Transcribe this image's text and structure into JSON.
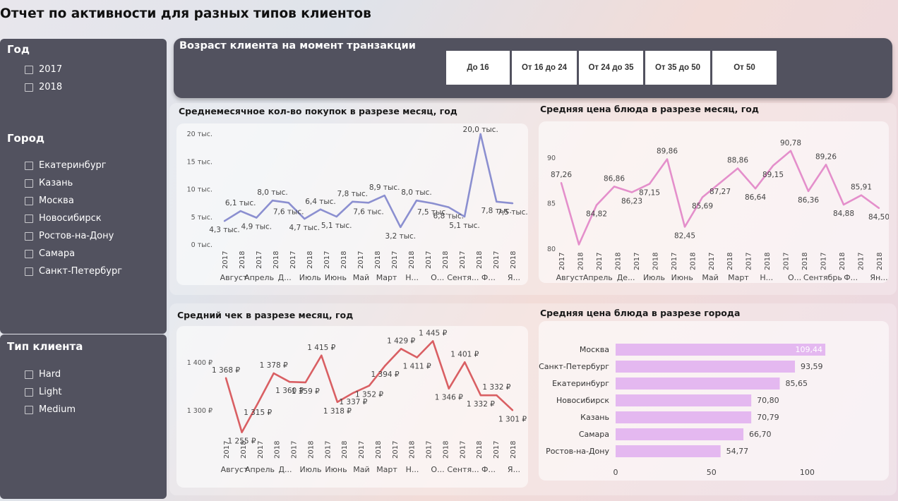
{
  "page_title": "Отчет по активности для разных типов клиентов",
  "filters": {
    "year": {
      "title": "Год",
      "items": [
        "2017",
        "2018"
      ]
    },
    "city": {
      "title": "Город",
      "items": [
        "Екатеринбург",
        "Казань",
        "Москва",
        "Новосибирск",
        "Ростов-на-Дону",
        "Самара",
        "Санкт-Петербург"
      ]
    },
    "client_type": {
      "title": "Тип клиента",
      "items": [
        "Hard",
        "Light",
        "Medium"
      ]
    }
  },
  "age_slicer": {
    "title": "Возраст клиента на момент транзакции",
    "buttons": [
      "До 16",
      "От 16 до 24",
      "От 24 до 35",
      "От 35 до 50",
      "От 50"
    ]
  },
  "colors": {
    "line1": "#8b8fd0",
    "line2": "#e48fcb",
    "line3": "#d95f63",
    "bar": "#e4b8f0",
    "panel": "#52525f"
  },
  "chart_data": [
    {
      "id": "purchases",
      "type": "line",
      "title": "Среднемесячное  кол-во покупок в разрезе месяц, год",
      "x_year_ticks": [
        "2017",
        "2018",
        "2017",
        "2018",
        "2017",
        "2018",
        "2017",
        "2018",
        "2017",
        "2018",
        "2017",
        "2018",
        "2017",
        "2018",
        "2017",
        "2018",
        "2017",
        "2018"
      ],
      "x_month_labels": [
        "Август",
        "Апрель",
        "Д...",
        "Июль",
        "Июнь",
        "Май",
        "Март",
        "Н...",
        "О...",
        "Сентя...",
        "Ф...",
        "Я..."
      ],
      "y_ticks": [
        "0 тыс.",
        "5 тыс.",
        "10 тыс.",
        "15 тыс.",
        "20 тыс."
      ],
      "ylim": [
        0,
        20
      ],
      "values": [
        4.3,
        6.1,
        4.9,
        8.0,
        7.6,
        4.7,
        6.4,
        5.1,
        7.8,
        7.6,
        8.9,
        3.2,
        8.0,
        7.5,
        6.8,
        5.1,
        20.0,
        7.8,
        7.5
      ],
      "data_labels": [
        "4,3 тыс.",
        "6,1 тыс.",
        "4,9 тыс.",
        "8,0 тыс.",
        "7,6 тыс.",
        "4,7 тыс.",
        "6,4 тыс.",
        "5,1 тыс.",
        "7,8 тыс.",
        "7,6 тыс.",
        "8,9 тыс.",
        "3,2 тыс.",
        "8,0 тыс.",
        "7,5 тыс.",
        "6,8 тыс.",
        "5,1 тыс.",
        "20,0 тыс.",
        "7,8 тыс.",
        "7,5 тыс."
      ]
    },
    {
      "id": "dish_price",
      "type": "line",
      "title": "Средняя цена блюда в разрезе месяц, год",
      "x_year_ticks": [
        "2017",
        "2018",
        "2017",
        "2018",
        "2017",
        "2018",
        "2017",
        "2018",
        "2017",
        "2018",
        "2017",
        "2018",
        "2017",
        "2018",
        "2017",
        "2018",
        "2017",
        "2018"
      ],
      "x_month_labels": [
        "Август",
        "Апрель",
        "Де...",
        "Июль",
        "Июнь",
        "Май",
        "Март",
        "Н...",
        "О...",
        "Сентябрь",
        "Ф...",
        "Ян..."
      ],
      "y_ticks": [
        "80",
        "85",
        "90"
      ],
      "ylim": [
        80,
        92
      ],
      "values": [
        87.26,
        80.5,
        84.82,
        86.86,
        86.23,
        87.15,
        89.86,
        82.45,
        85.69,
        87.27,
        88.86,
        86.64,
        89.15,
        90.78,
        86.36,
        89.26,
        84.88,
        85.91,
        84.5
      ],
      "data_labels": [
        "87,26",
        "",
        "84,82",
        "86,86",
        "86,23",
        "87,15",
        "89,86",
        "82,45",
        "85,69",
        "87,27",
        "88,86",
        "86,64",
        "89,15",
        "90,78",
        "86,36",
        "89,26",
        "84,88",
        "85,91",
        "84,50"
      ]
    },
    {
      "id": "avg_check",
      "type": "line",
      "title": "Средний чек в разрезе месяц, год",
      "x_year_ticks": [
        "2017",
        "2018",
        "2017",
        "2018",
        "2017",
        "2018",
        "2017",
        "2018",
        "2017",
        "2018",
        "2017",
        "2018",
        "2017",
        "2018",
        "2017",
        "2018",
        "2017",
        "2018"
      ],
      "x_month_labels": [
        "Август",
        "Апрель",
        "Д...",
        "Июль",
        "Июнь",
        "Май",
        "Март",
        "Н...",
        "О...",
        "Сентя...",
        "Ф...",
        "Я..."
      ],
      "y_ticks": [
        "1 300 ₽",
        "1 400 ₽"
      ],
      "ylim": [
        1250,
        1450
      ],
      "values": [
        1368,
        1255,
        1315,
        1378,
        1360,
        1359,
        1415,
        1318,
        1337,
        1352,
        1394,
        1429,
        1411,
        1445,
        1346,
        1401,
        1332,
        1332,
        1301
      ],
      "data_labels": [
        "1 368 ₽",
        "1 255 ₽",
        "1 315 ₽",
        "1 378 ₽",
        "1 360 ₽",
        "1 359 ₽",
        "1 415 ₽",
        "1 318 ₽",
        "1 337 ₽",
        "1 352 ₽",
        "1 394 ₽",
        "1 429 ₽",
        "1 411 ₽",
        "1 445 ₽",
        "1 346 ₽",
        "1 401 ₽",
        "1 332 ₽",
        "1 332 ₽",
        "1 301 ₽"
      ]
    },
    {
      "id": "dish_price_city",
      "type": "bar",
      "title": "Средняя цена блюда в разрезе города",
      "categories": [
        "Москва",
        "Санкт-Петербург",
        "Екатеринбург",
        "Новосибирск",
        "Казань",
        "Самара",
        "Ростов-на-Дону"
      ],
      "values": [
        109.44,
        93.59,
        85.65,
        70.8,
        70.79,
        66.7,
        54.77
      ],
      "data_labels": [
        "109,44",
        "93,59",
        "85,65",
        "70,80",
        "70,79",
        "66,70",
        "54,77"
      ],
      "x_ticks": [
        "0",
        "50",
        "100"
      ],
      "xlim": [
        0,
        112
      ]
    }
  ]
}
